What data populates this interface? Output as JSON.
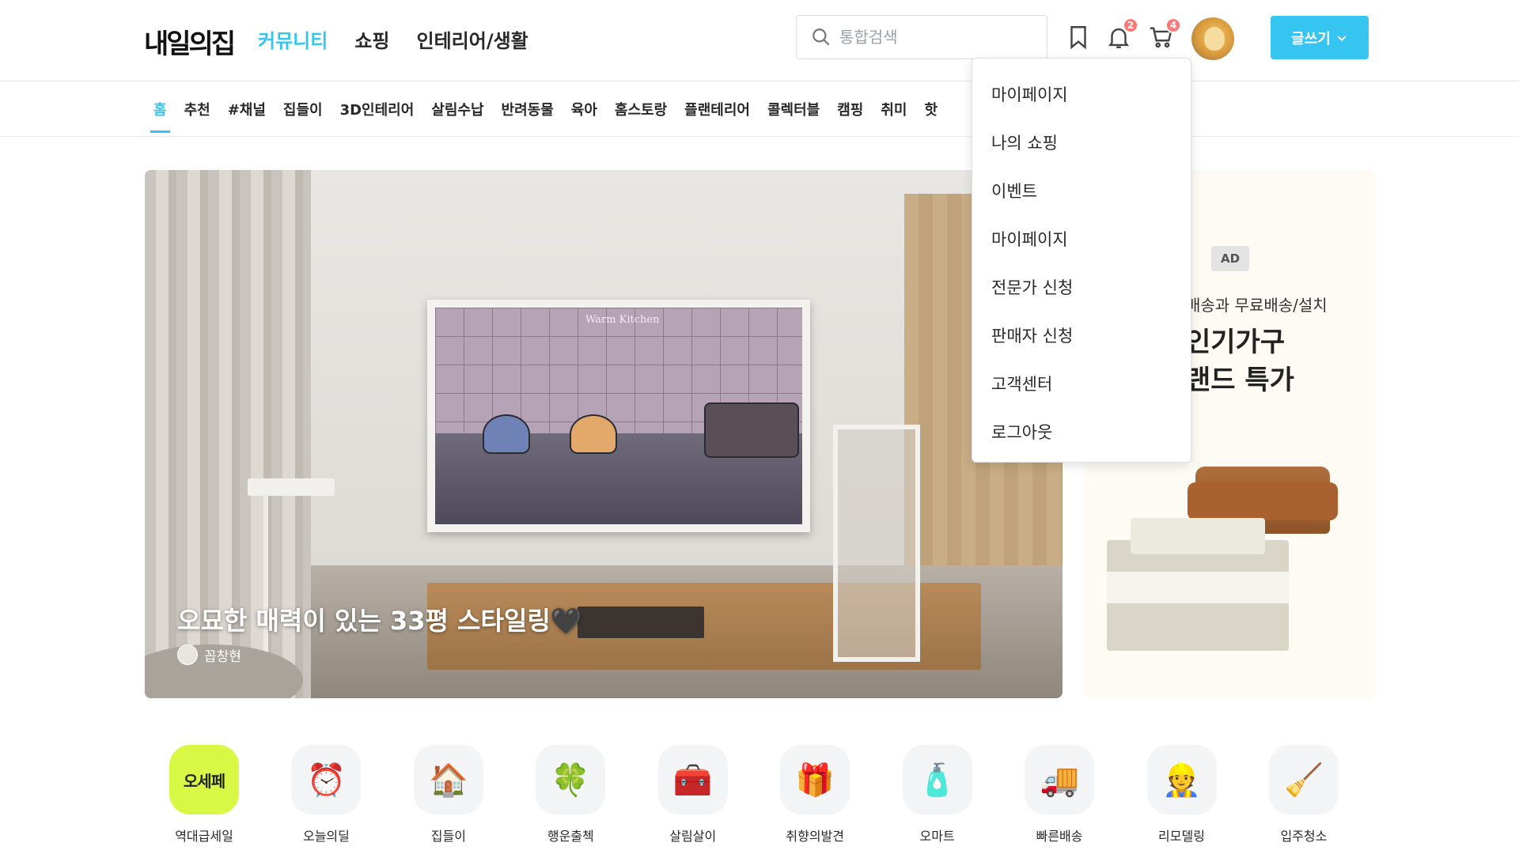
{
  "header": {
    "logo": "내일의집",
    "nav": [
      "커뮤니티",
      "쇼핑",
      "인테리어/생활"
    ],
    "search_placeholder": "통합검색",
    "notification_count": "2",
    "cart_count": "4",
    "write_button": "글쓰기"
  },
  "subnav": {
    "items": [
      "홈",
      "추천",
      "#채널",
      "집들이",
      "3D인테리어",
      "살림수납",
      "반려동물",
      "육아",
      "홈스토랑",
      "플랜테리어",
      "콜렉터블",
      "캠핑",
      "취미",
      "핫"
    ]
  },
  "hero": {
    "title": "오묘한 매력이 있는 33평 스타일링🖤",
    "author": "꼽창현",
    "frame_caption": "Warm Kitchen"
  },
  "ad": {
    "badge": "AD",
    "subtitle": "배송과 무료배송/설치",
    "line1": "인기가구",
    "line2": "랜드 특가"
  },
  "quick_menu": [
    {
      "label": "역대급세일",
      "icon": "오세페"
    },
    {
      "label": "오늘의딜",
      "icon": "⏰"
    },
    {
      "label": "집들이",
      "icon": "🏠"
    },
    {
      "label": "행운출첵",
      "icon": "🍀"
    },
    {
      "label": "살림살이",
      "icon": "🧰"
    },
    {
      "label": "취향의발견",
      "icon": "🎁"
    },
    {
      "label": "오마트",
      "icon": "🧴"
    },
    {
      "label": "빠른배송",
      "icon": "🚚"
    },
    {
      "label": "리모델링",
      "icon": "👷"
    },
    {
      "label": "입주청소",
      "icon": "🧹"
    }
  ],
  "dropdown": {
    "items": [
      "마이페이지",
      "나의 쇼핑",
      "이벤트",
      "마이페이지",
      "전문가 신청",
      "판매자 신청",
      "고객센터",
      "로그아웃"
    ]
  },
  "colors": {
    "accent": "#35c5f0",
    "badge": "#ff7777"
  }
}
